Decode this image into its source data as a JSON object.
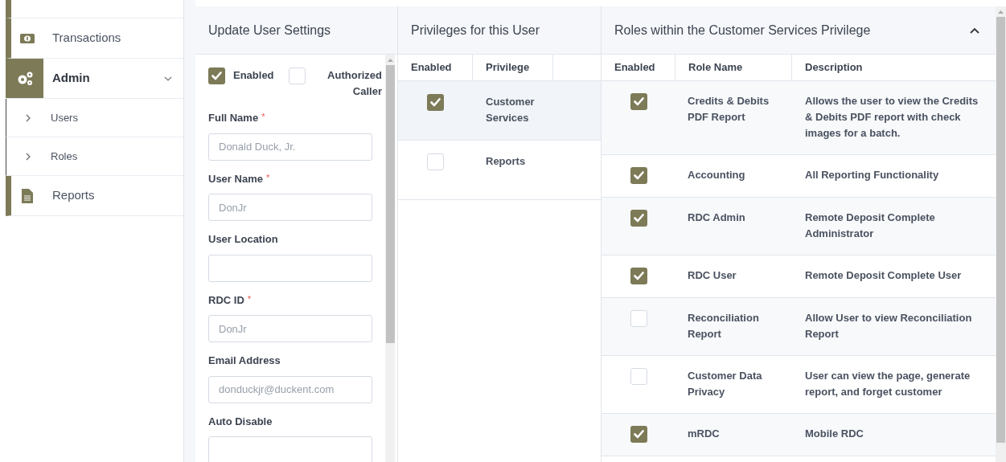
{
  "sidebar": {
    "items": [
      {
        "label": "Transactions",
        "selected": false
      },
      {
        "label": "Admin",
        "selected": true,
        "expanded": true,
        "children": [
          {
            "label": "Users"
          },
          {
            "label": "Roles"
          }
        ]
      },
      {
        "label": "Reports",
        "selected": false
      }
    ]
  },
  "settings_panel": {
    "title": "Update User Settings",
    "checkboxes": [
      {
        "label": "Enabled",
        "checked": true
      },
      {
        "label": "Authorized Caller",
        "checked": false
      }
    ],
    "fields": [
      {
        "label": "Full Name",
        "required_mark": "*",
        "placeholder": "Donald Duck, Jr."
      },
      {
        "label": "User Name",
        "required_mark": "*",
        "placeholder": "DonJr"
      },
      {
        "label": "User Location"
      },
      {
        "label": "RDC ID",
        "required_mark": "*",
        "placeholder": "DonJr"
      },
      {
        "label": "Email Address",
        "placeholder": "donduckjr@duckent.com"
      },
      {
        "label": "Auto Disable"
      }
    ]
  },
  "privileges_panel": {
    "title": "Privileges for this User",
    "columns": [
      "Enabled",
      "Privilege"
    ],
    "rows": [
      {
        "privilege": "Customer Services",
        "enabled": true,
        "selected": true
      },
      {
        "privilege": "Reports",
        "enabled": false,
        "selected": false
      }
    ]
  },
  "roles_panel": {
    "title": "Roles within the Customer Services Privilege",
    "expanded": true,
    "columns": [
      "Enabled",
      "Role Name",
      "Description"
    ],
    "rows": [
      {
        "enabled": true,
        "role": "Credits & Debits PDF Report",
        "description": "Allows the user to view the Credits & Debits PDF report with check images for a batch."
      },
      {
        "enabled": true,
        "role": "Accounting",
        "description": "All Reporting Functionality"
      },
      {
        "enabled": true,
        "role": "RDC Admin",
        "description": "Remote Deposit Complete Administrator"
      },
      {
        "enabled": true,
        "role": "RDC User",
        "description": "Remote Deposit Complete User"
      },
      {
        "enabled": false,
        "role": "Reconciliation Report",
        "description": "Allow User to view Reconciliation Report"
      },
      {
        "enabled": false,
        "role": "Customer Data Privacy",
        "description": "User can view the page, generate report, and forget customer"
      },
      {
        "enabled": true,
        "role": "mRDC",
        "description": "Mobile RDC"
      }
    ]
  }
}
